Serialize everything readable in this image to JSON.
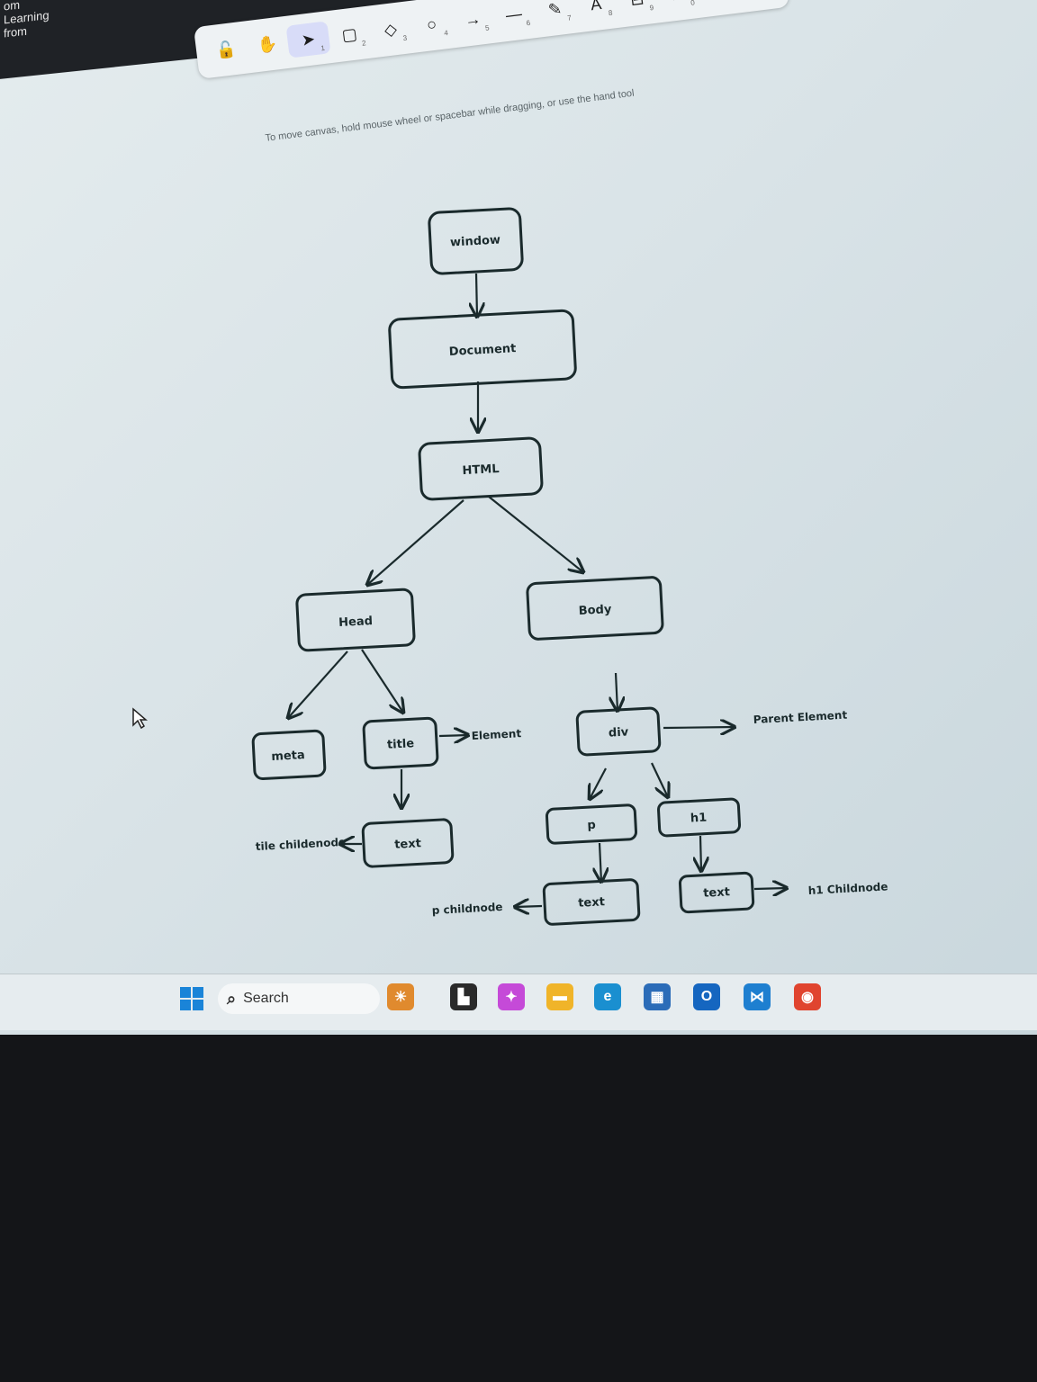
{
  "window": {
    "title": "om Learning from"
  },
  "toolbar": {
    "tools": [
      {
        "name": "lock-icon",
        "glyph": "🔓",
        "key": ""
      },
      {
        "name": "hand-icon",
        "glyph": "✋",
        "key": ""
      },
      {
        "name": "selection-icon",
        "glyph": "➤",
        "key": "1"
      },
      {
        "name": "rectangle-icon",
        "glyph": "▢",
        "key": "2"
      },
      {
        "name": "diamond-icon",
        "glyph": "◇",
        "key": "3"
      },
      {
        "name": "ellipse-icon",
        "glyph": "○",
        "key": "4"
      },
      {
        "name": "arrow-icon",
        "glyph": "→",
        "key": "5"
      },
      {
        "name": "line-icon",
        "glyph": "—",
        "key": "6"
      },
      {
        "name": "pencil-icon",
        "glyph": "✎",
        "key": "7"
      },
      {
        "name": "text-icon",
        "glyph": "A",
        "key": "8"
      },
      {
        "name": "image-icon",
        "glyph": "⊟",
        "key": "9"
      },
      {
        "name": "eraser-icon",
        "glyph": "⌫",
        "key": "0"
      },
      {
        "name": "library-icon",
        "glyph": "⛬",
        "key": ""
      }
    ],
    "hint": "To move canvas, hold mouse wheel or spacebar while dragging, or use the hand tool"
  },
  "diagram": {
    "nodes": {
      "window": "window",
      "document": "Document",
      "html": "HTML",
      "head": "Head",
      "body": "Body",
      "meta": "meta",
      "title": "title",
      "div": "div",
      "title_text": "text",
      "p": "p",
      "h1": "h1",
      "p_text": "text",
      "h1_text": "text"
    },
    "labels": {
      "element": "Element",
      "parent_element": "Parent Element",
      "title_childnode": "tile childenode",
      "p_childnode": "p childnode",
      "h1_childnode": "h1 Childnode"
    }
  },
  "taskbar": {
    "search_label": "Search",
    "apps": [
      {
        "name": "widgets-icon",
        "color": "#e08a2e",
        "glyph": "☀"
      },
      {
        "name": "task-view-icon",
        "color": "#2a2a2a",
        "glyph": "▙"
      },
      {
        "name": "copilot-icon",
        "color": "#c54ad8",
        "glyph": "✦"
      },
      {
        "name": "file-explorer-icon",
        "color": "#f0b429",
        "glyph": "▬"
      },
      {
        "name": "edge-icon",
        "color": "#1a8fd0",
        "glyph": "e"
      },
      {
        "name": "store-icon",
        "color": "#2b6cb8",
        "glyph": "▦"
      },
      {
        "name": "outlook-icon",
        "color": "#1566c0",
        "glyph": "O"
      },
      {
        "name": "vscode-icon",
        "color": "#1e7fd0",
        "glyph": "⋈"
      },
      {
        "name": "chrome-icon",
        "color": "#e0442f",
        "glyph": "◉"
      }
    ]
  }
}
